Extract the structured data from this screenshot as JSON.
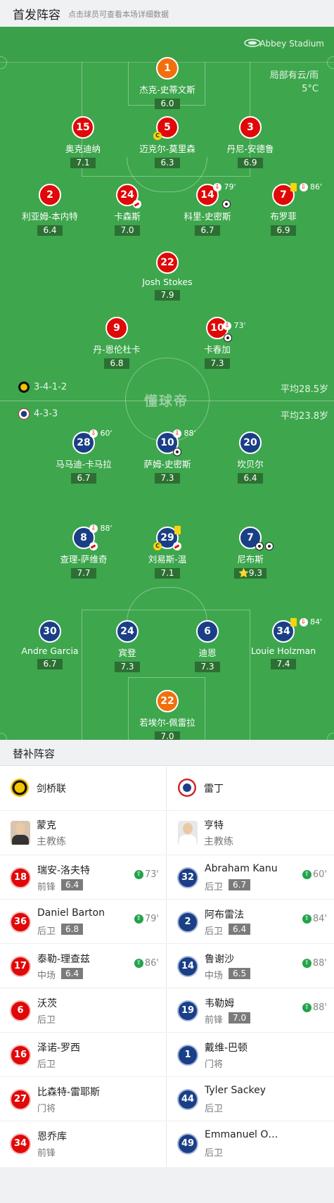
{
  "header": {
    "title": "首发阵容",
    "subtitle": "点击球员可查看本场详细数据"
  },
  "pitch": {
    "stadium": "Abbey Stadium",
    "weather": "局部有云/雨",
    "temperature": "5°C",
    "watermark": "懂球帝",
    "home_formation": "3-4-1-2",
    "home_avg_age": "平均28.5岁",
    "away_formation": "4-3-3",
    "away_avg_age": "平均23.8岁",
    "colors": {
      "home": "#e00808",
      "home_keeper": "#f36f0d",
      "away": "#1a3f86",
      "pitch": "#3ea64d"
    }
  },
  "home": [
    {
      "num": "1",
      "name": "杰克-史蒂文斯",
      "rating": "6.0",
      "keeper": true
    },
    {
      "num": "15",
      "name": "奥克迪纳",
      "rating": "7.1"
    },
    {
      "num": "5",
      "name": "迈克尔-莫里森",
      "rating": "6.3",
      "captain": true
    },
    {
      "num": "3",
      "name": "丹尼-安德鲁",
      "rating": "6.9"
    },
    {
      "num": "2",
      "name": "利亚姆-本内特",
      "rating": "6.4"
    },
    {
      "num": "24",
      "name": "卡森斯",
      "rating": "7.0"
    },
    {
      "num": "14",
      "name": "科里-史密斯",
      "rating": "6.7",
      "sub_min": "79'"
    },
    {
      "num": "7",
      "name": "布罗菲",
      "rating": "6.9",
      "sub_min": "86'"
    },
    {
      "num": "22",
      "name": "Josh Stokes",
      "rating": "7.9"
    },
    {
      "num": "9",
      "name": "丹-恩伦杜卡",
      "rating": "6.8"
    },
    {
      "num": "10",
      "name": "卡春加",
      "rating": "7.3",
      "sub_min": "73'"
    }
  ],
  "away": [
    {
      "num": "28",
      "name": "马马迪-卡马拉",
      "rating": "6.7",
      "sub_min": "60'"
    },
    {
      "num": "10",
      "name": "萨姆-史密斯",
      "rating": "7.3",
      "sub_min": "88'"
    },
    {
      "num": "20",
      "name": "坎贝尔",
      "rating": "6.4"
    },
    {
      "num": "8",
      "name": "查理-萨维奇",
      "rating": "7.7",
      "sub_min": "88'"
    },
    {
      "num": "29",
      "name": "刘易斯-温",
      "rating": "7.1",
      "captain": true
    },
    {
      "num": "7",
      "name": "尼布斯",
      "rating": "9.3",
      "star": "⭐"
    },
    {
      "num": "30",
      "name": "Andre Garcia",
      "rating": "6.7"
    },
    {
      "num": "24",
      "name": "宾登",
      "rating": "7.3"
    },
    {
      "num": "6",
      "name": "迪恩",
      "rating": "7.3"
    },
    {
      "num": "34",
      "name": "Louie Holzman",
      "rating": "7.4",
      "sub_min": "84'"
    },
    {
      "num": "22",
      "name": "若埃尔-佩雷拉",
      "rating": "7.0",
      "keeper": true
    }
  ],
  "subs": {
    "title": "替补阵容",
    "left": {
      "team": "剑桥联",
      "coach_name": "蒙克",
      "coach_role": "主教练",
      "players": [
        {
          "num": "18",
          "name": "瑞安-洛夫特",
          "pos": "前锋",
          "rating": "6.4",
          "min": "73'"
        },
        {
          "num": "36",
          "name": "Daniel Barton",
          "pos": "后卫",
          "rating": "6.8",
          "min": "79'"
        },
        {
          "num": "17",
          "name": "泰勒-理查兹",
          "pos": "中场",
          "rating": "6.4",
          "min": "86'"
        },
        {
          "num": "6",
          "name": "沃茨",
          "pos": "后卫"
        },
        {
          "num": "16",
          "name": "泽诺-罗西",
          "pos": "后卫"
        },
        {
          "num": "27",
          "name": "比森特-雷耶斯",
          "pos": "门将"
        },
        {
          "num": "34",
          "name": "恩乔库",
          "pos": "前锋"
        }
      ]
    },
    "right": {
      "team": "雷丁",
      "coach_name": "亨特",
      "coach_role": "主教练",
      "players": [
        {
          "num": "32",
          "name": "Abraham Kanu",
          "pos": "后卫",
          "rating": "6.7",
          "min": "60'"
        },
        {
          "num": "2",
          "name": "阿布雷法",
          "pos": "后卫",
          "rating": "6.4",
          "min": "84'"
        },
        {
          "num": "14",
          "name": "鲁谢沙",
          "pos": "中场",
          "rating": "6.5",
          "min": "88'"
        },
        {
          "num": "19",
          "name": "韦勒姆",
          "pos": "前锋",
          "rating": "7.0",
          "min": "88'"
        },
        {
          "num": "1",
          "name": "戴维-巴顿",
          "pos": "门将"
        },
        {
          "num": "44",
          "name": "Tyler Sackey",
          "pos": "后卫"
        },
        {
          "num": "49",
          "name": "Emmanuel O…",
          "pos": "后卫"
        }
      ]
    }
  }
}
